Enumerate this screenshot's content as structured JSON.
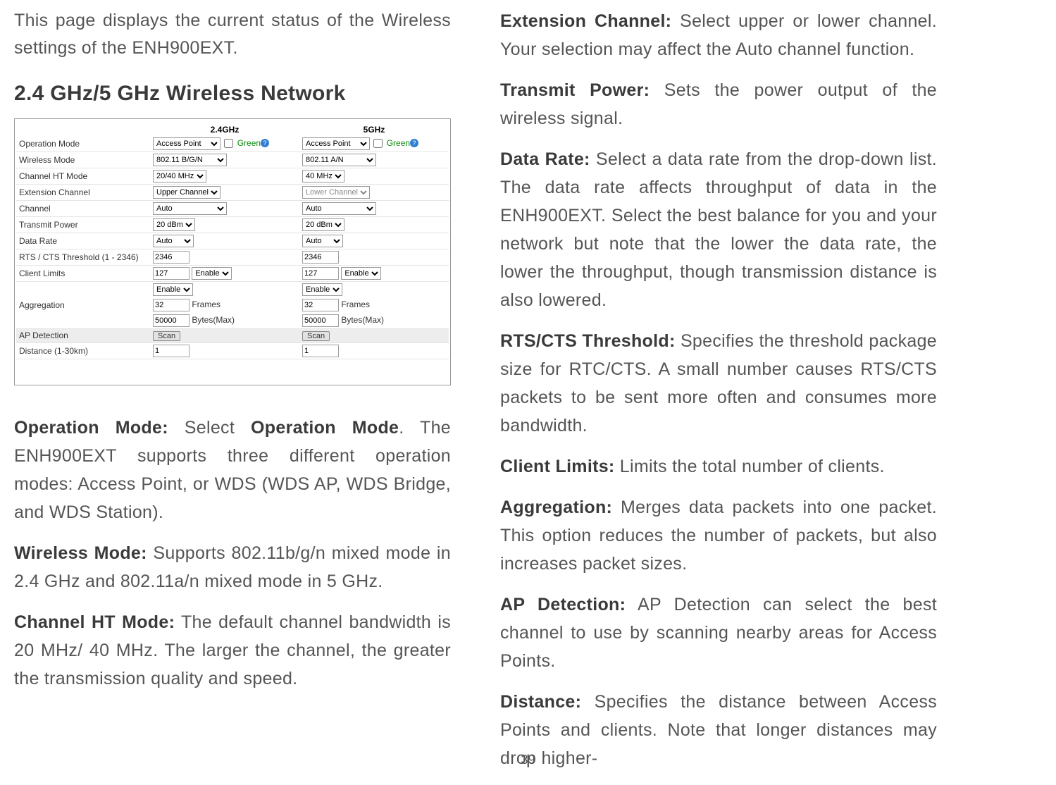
{
  "page": {
    "number": "39"
  },
  "left": {
    "intro": "This page displays the current status of the Wireless settings of the ENH900EXT.",
    "heading": "2.4 GHz/5 GHz Wireless Network",
    "definitions": {
      "op_mode": {
        "term": "Operation Mode:",
        "text": " Select ",
        "term2": "Operation Mode",
        "text2": ". The ENH900EXT supports three different operation modes: Access Point, or WDS (WDS AP, WDS Bridge, and WDS Station)."
      },
      "wireless_mode": {
        "term": "Wireless Mode:",
        "text": " Supports 802.11b/g/n mixed mode in 2.4 GHz and 802.11a/n mixed mode in 5 GHz."
      },
      "channel_ht": {
        "term": "Channel HT Mode:",
        "text": " The default channel bandwidth is 20 MHz/ 40 MHz. The larger the channel, the greater the transmission quality and speed."
      }
    }
  },
  "right": {
    "ext_channel": {
      "term": "Extension Channel:",
      "text": " Select upper or lower channel. Your selection may affect the Auto channel function."
    },
    "transmit_power": {
      "term": "Transmit Power:",
      "text": " Sets the power output of the wireless signal."
    },
    "data_rate": {
      "term": "Data Rate:",
      "text": " Select a data rate from the drop-down list. The data rate affects throughput of data in the ENH900EXT. Select the best balance for you and your network but note that the lower the data rate, the lower the throughput, though transmission distance is also lowered."
    },
    "rts": {
      "term": "RTS/CTS Threshold:",
      "text": " Specifies the threshold package size for RTC/CTS. A small number causes RTS/CTS packets to be sent more often and consumes more bandwidth."
    },
    "client_limits": {
      "term": "Client Limits:",
      "text": " Limits the total number of clients."
    },
    "aggregation": {
      "term": "Aggregation:",
      "text": " Merges data packets into one packet. This option reduces the number of packets, but also increases packet sizes."
    },
    "ap_detection": {
      "term": "AP Detection:",
      "text": " AP Detection can select the best channel to use by scanning nearby areas for Access Points."
    },
    "distance": {
      "term": "Distance:",
      "text": " Specifies the distance between Access Points and clients. Note that longer distances may drop higher-"
    }
  },
  "table": {
    "headers": {
      "col1": "2.4GHz",
      "col2": "5GHz"
    },
    "labels": {
      "op_mode": "Operation Mode",
      "wireless_mode": "Wireless Mode",
      "channel_ht": "Channel HT Mode",
      "ext_channel": "Extension Channel",
      "channel": "Channel",
      "transmit_power": "Transmit Power",
      "data_rate": "Data Rate",
      "rts": "RTS / CTS Threshold (1 - 2346)",
      "client_limits": "Client Limits",
      "aggregation": "Aggregation",
      "ap_detection": "AP Detection",
      "distance": "Distance (1-30km)"
    },
    "values": {
      "op_mode_24": "Access Point",
      "op_mode_5": "Access Point",
      "green": "Green",
      "wireless_24": "802.11 B/G/N",
      "wireless_5": "802.11 A/N",
      "ht_24": "20/40 MHz",
      "ht_5": "40 MHz",
      "ext_24": "Upper Channel",
      "ext_5": "Lower Channel",
      "channel_24": "Auto",
      "channel_5": "Auto",
      "power_24": "20 dBm",
      "power_5": "20 dBm",
      "rate_24": "Auto",
      "rate_5": "Auto",
      "rts_24": "2346",
      "rts_5": "2346",
      "client_24": "127",
      "client_5": "127",
      "client_enable": "Enable",
      "agg_enable": "Enable",
      "agg_frames_24": "32",
      "agg_frames_5": "32",
      "frames_label": "Frames",
      "agg_bytes_24": "50000",
      "agg_bytes_5": "50000",
      "bytes_label": "Bytes(Max)",
      "scan": "Scan",
      "distance_24": "1",
      "distance_5": "1"
    }
  }
}
